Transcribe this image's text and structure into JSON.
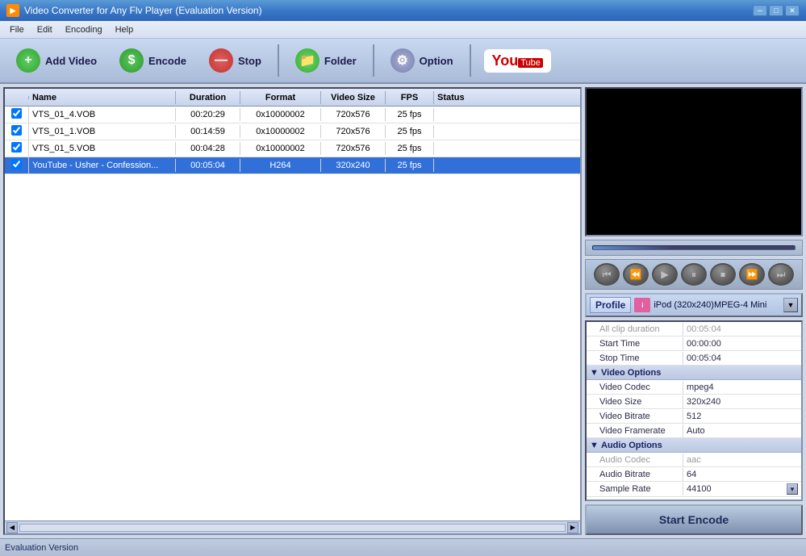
{
  "titlebar": {
    "icon": "▶",
    "title": "Video Converter for Any Flv Player (Evaluation Version)",
    "min_btn": "─",
    "max_btn": "□",
    "close_btn": "✕"
  },
  "menubar": {
    "items": [
      {
        "id": "file",
        "label": "File"
      },
      {
        "id": "edit",
        "label": "Edit"
      },
      {
        "id": "encoding",
        "label": "Encoding"
      },
      {
        "id": "help",
        "label": "Help"
      }
    ]
  },
  "toolbar": {
    "add_video": "Add Video",
    "encode": "Encode",
    "stop": "Stop",
    "folder": "Folder",
    "option": "Option",
    "youtube_text": "You",
    "youtube_tube": "Tube"
  },
  "file_list": {
    "columns": {
      "check": "",
      "name": "Name",
      "duration": "Duration",
      "format": "Format",
      "video_size": "Video Size",
      "fps": "FPS",
      "status": "Status"
    },
    "rows": [
      {
        "checked": true,
        "name": "VTS_01_4.VOB",
        "duration": "00:20:29",
        "format": "0x10000002",
        "video_size": "720x576",
        "fps": "25 fps",
        "status": "",
        "selected": false
      },
      {
        "checked": true,
        "name": "VTS_01_1.VOB",
        "duration": "00:14:59",
        "format": "0x10000002",
        "video_size": "720x576",
        "fps": "25 fps",
        "status": "",
        "selected": false
      },
      {
        "checked": true,
        "name": "VTS_01_5.VOB",
        "duration": "00:04:28",
        "format": "0x10000002",
        "video_size": "720x576",
        "fps": "25 fps",
        "status": "",
        "selected": false
      },
      {
        "checked": true,
        "name": "YouTube - Usher - Confession...",
        "duration": "00:05:04",
        "format": "H264",
        "video_size": "320x240",
        "fps": "25 fps",
        "status": "",
        "selected": true
      }
    ]
  },
  "player_buttons": [
    {
      "id": "rewind",
      "icon": "⏮",
      "label": "rewind"
    },
    {
      "id": "prev-frame",
      "icon": "⏪",
      "label": "previous-frame"
    },
    {
      "id": "play",
      "icon": "▶",
      "label": "play"
    },
    {
      "id": "pause",
      "icon": "⏸",
      "label": "pause"
    },
    {
      "id": "stop-player",
      "icon": "⏹",
      "label": "stop-player"
    },
    {
      "id": "next-frame",
      "icon": "⏩",
      "label": "next-frame"
    },
    {
      "id": "forward",
      "icon": "⏭",
      "label": "forward"
    }
  ],
  "profile": {
    "label": "Profile",
    "value": "iPod (320x240)MPEG-4 Mini",
    "icon": "iPod"
  },
  "properties": {
    "clip_duration_label": "All clip duration",
    "clip_duration_value": "00:05:04",
    "start_time_label": "Start Time",
    "start_time_value": "00:00:00",
    "stop_time_label": "Stop Time",
    "stop_time_value": "00:05:04",
    "video_options_label": "Video Options",
    "video_codec_label": "Video Codec",
    "video_codec_value": "mpeg4",
    "video_size_label": "Video Size",
    "video_size_value": "320x240",
    "video_bitrate_label": "Video Bitrate",
    "video_bitrate_value": "512",
    "video_framerate_label": "Video Framerate",
    "video_framerate_value": "Auto",
    "audio_options_label": "Audio Options",
    "audio_codec_label": "Audio Codec",
    "audio_codec_value": "aac",
    "audio_bitrate_label": "Audio Bitrate",
    "audio_bitrate_value": "64",
    "sample_rate_label": "Sample Rate",
    "sample_rate_value": "44100"
  },
  "start_encode_btn": "Start Encode",
  "status_bar": {
    "text": "Evaluation Version"
  }
}
